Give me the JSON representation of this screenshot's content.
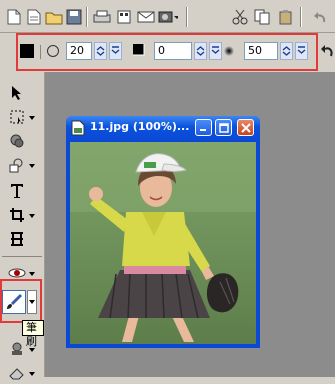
{
  "options": {
    "size_value": "20",
    "hardness_value": "0",
    "opacity_value": "50"
  },
  "image_window": {
    "title": "11.jpg (100%)..."
  },
  "tooltip": {
    "text": "筆刷"
  },
  "colors": {
    "highlight": "#e23a3a",
    "titlebar": "#0a49d6",
    "close_button": "#c8431c"
  }
}
